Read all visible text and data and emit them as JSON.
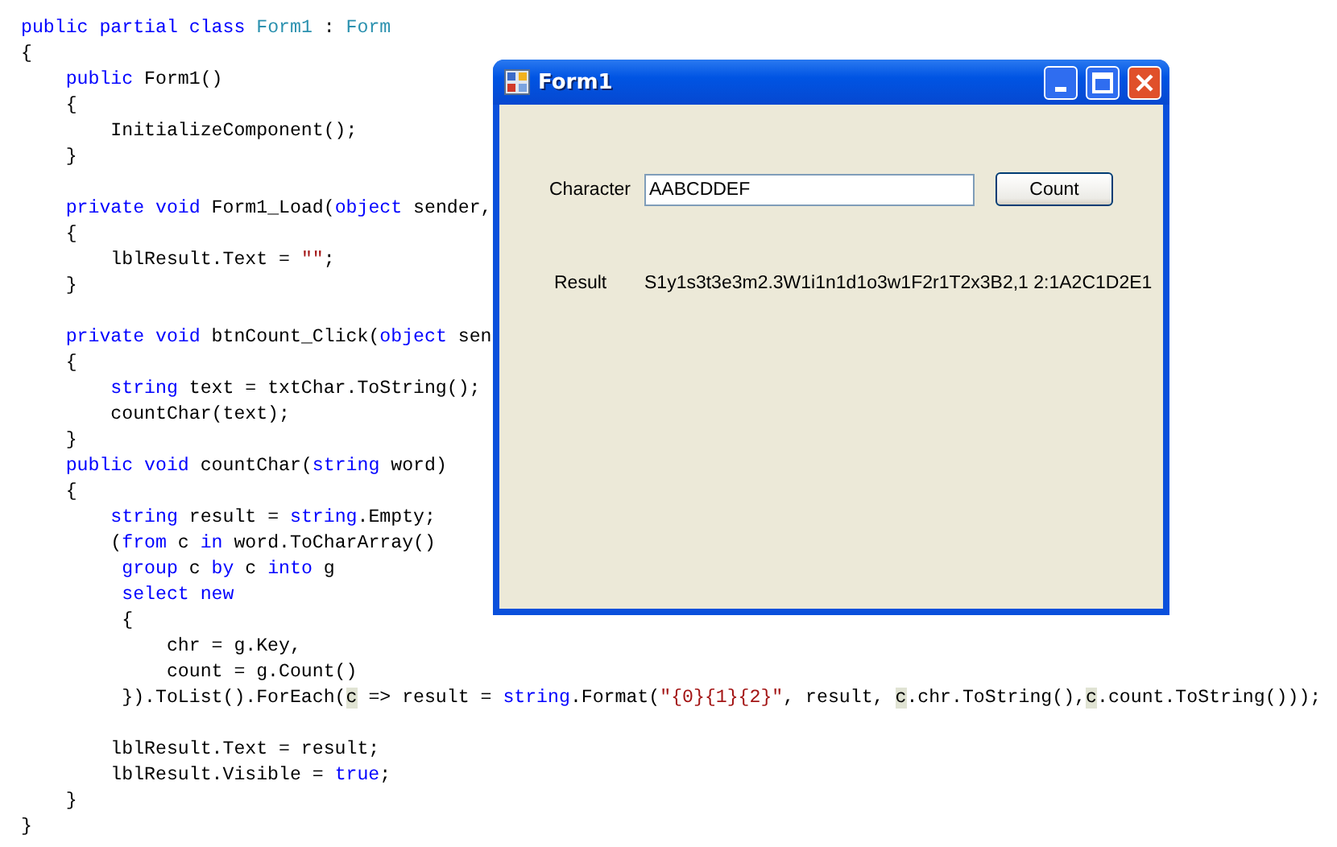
{
  "code": {
    "blocks": [
      [
        [
          {
            "kind": "keyword",
            "text": "public partial class "
          },
          {
            "kind": "type",
            "text": "Form1"
          },
          {
            "kind": "plain",
            "text": " : "
          },
          {
            "kind": "type",
            "text": "Form"
          }
        ],
        [
          {
            "kind": "plain",
            "text": "{"
          }
        ],
        [
          {
            "kind": "keyword",
            "text": "    public"
          },
          {
            "kind": "plain",
            "text": " Form1()"
          }
        ],
        [
          {
            "kind": "plain",
            "text": "    {"
          }
        ],
        [
          {
            "kind": "plain",
            "text": "        InitializeComponent();"
          }
        ],
        [
          {
            "kind": "plain",
            "text": "    }"
          }
        ]
      ],
      [
        [
          {
            "kind": "keyword",
            "text": "    private void"
          },
          {
            "kind": "plain",
            "text": " Form1_Load("
          },
          {
            "kind": "keyword",
            "text": "object"
          },
          {
            "kind": "plain",
            "text": " sender,"
          }
        ],
        [
          {
            "kind": "plain",
            "text": "    {"
          }
        ],
        [
          {
            "kind": "plain",
            "text": "        lblResult.Text = "
          },
          {
            "kind": "string",
            "text": "\"\""
          },
          {
            "kind": "plain",
            "text": ";"
          }
        ],
        [
          {
            "kind": "plain",
            "text": "    }"
          }
        ]
      ],
      [
        [
          {
            "kind": "keyword",
            "text": "    private void"
          },
          {
            "kind": "plain",
            "text": " btnCount_Click("
          },
          {
            "kind": "keyword",
            "text": "object"
          },
          {
            "kind": "plain",
            "text": " sen"
          }
        ],
        [
          {
            "kind": "plain",
            "text": "    {"
          }
        ],
        [
          {
            "kind": "keyword",
            "text": "        string"
          },
          {
            "kind": "plain",
            "text": " text = txtChar.ToString();"
          }
        ],
        [
          {
            "kind": "plain",
            "text": "        countChar(text);"
          }
        ],
        [
          {
            "kind": "plain",
            "text": "    }"
          }
        ],
        [
          {
            "kind": "keyword",
            "text": "    public void"
          },
          {
            "kind": "plain",
            "text": " countChar("
          },
          {
            "kind": "keyword",
            "text": "string"
          },
          {
            "kind": "plain",
            "text": " word)"
          }
        ],
        [
          {
            "kind": "plain",
            "text": "    {"
          }
        ],
        [
          {
            "kind": "keyword",
            "text": "        string"
          },
          {
            "kind": "plain",
            "text": " result = "
          },
          {
            "kind": "keyword",
            "text": "string"
          },
          {
            "kind": "plain",
            "text": ".Empty;"
          }
        ],
        [
          {
            "kind": "plain",
            "text": "        ("
          },
          {
            "kind": "keyword",
            "text": "from"
          },
          {
            "kind": "plain",
            "text": " c "
          },
          {
            "kind": "keyword",
            "text": "in"
          },
          {
            "kind": "plain",
            "text": " word.ToCharArray()"
          }
        ],
        [
          {
            "kind": "keyword",
            "text": "         group"
          },
          {
            "kind": "plain",
            "text": " c "
          },
          {
            "kind": "keyword",
            "text": "by"
          },
          {
            "kind": "plain",
            "text": " c "
          },
          {
            "kind": "keyword",
            "text": "into"
          },
          {
            "kind": "plain",
            "text": " g"
          }
        ],
        [
          {
            "kind": "keyword",
            "text": "         select new"
          }
        ],
        [
          {
            "kind": "plain",
            "text": "         {"
          }
        ],
        [
          {
            "kind": "plain",
            "text": "             chr = g.Key,"
          }
        ],
        [
          {
            "kind": "plain",
            "text": "             count = g.Count()"
          }
        ],
        [
          {
            "kind": "plain",
            "text": "         }).ToList().ForEach("
          },
          {
            "kind": "highlight",
            "text": "c"
          },
          {
            "kind": "plain",
            "text": " => result = "
          },
          {
            "kind": "keyword",
            "text": "string"
          },
          {
            "kind": "plain",
            "text": ".Format("
          },
          {
            "kind": "string",
            "text": "\"{0}{1}{2}\""
          },
          {
            "kind": "plain",
            "text": ", result, "
          },
          {
            "kind": "highlight",
            "text": "c"
          },
          {
            "kind": "plain",
            "text": ".chr.ToString(),"
          },
          {
            "kind": "highlight",
            "text": "c"
          },
          {
            "kind": "plain",
            "text": ".count.ToString()));"
          }
        ]
      ],
      [
        [
          {
            "kind": "plain",
            "text": "        lblResult.Text = result;"
          }
        ],
        [
          {
            "kind": "plain",
            "text": "        lblResult.Visible = "
          },
          {
            "kind": "keyword",
            "text": "true"
          },
          {
            "kind": "plain",
            "text": ";"
          }
        ],
        [
          {
            "kind": "plain",
            "text": "    }"
          }
        ],
        [
          {
            "kind": "plain",
            "text": "}"
          }
        ]
      ]
    ]
  },
  "window": {
    "title": "Form1",
    "character_label": "Character",
    "character_field": {
      "value": "AABCDDEF"
    },
    "count_button": "Count",
    "result_label": "Result",
    "result_value": "S1y1s3t3e3m2.3W1i1n1d1o3w1F2r1T2x3B2,1 2:1A2C1D2E1"
  }
}
